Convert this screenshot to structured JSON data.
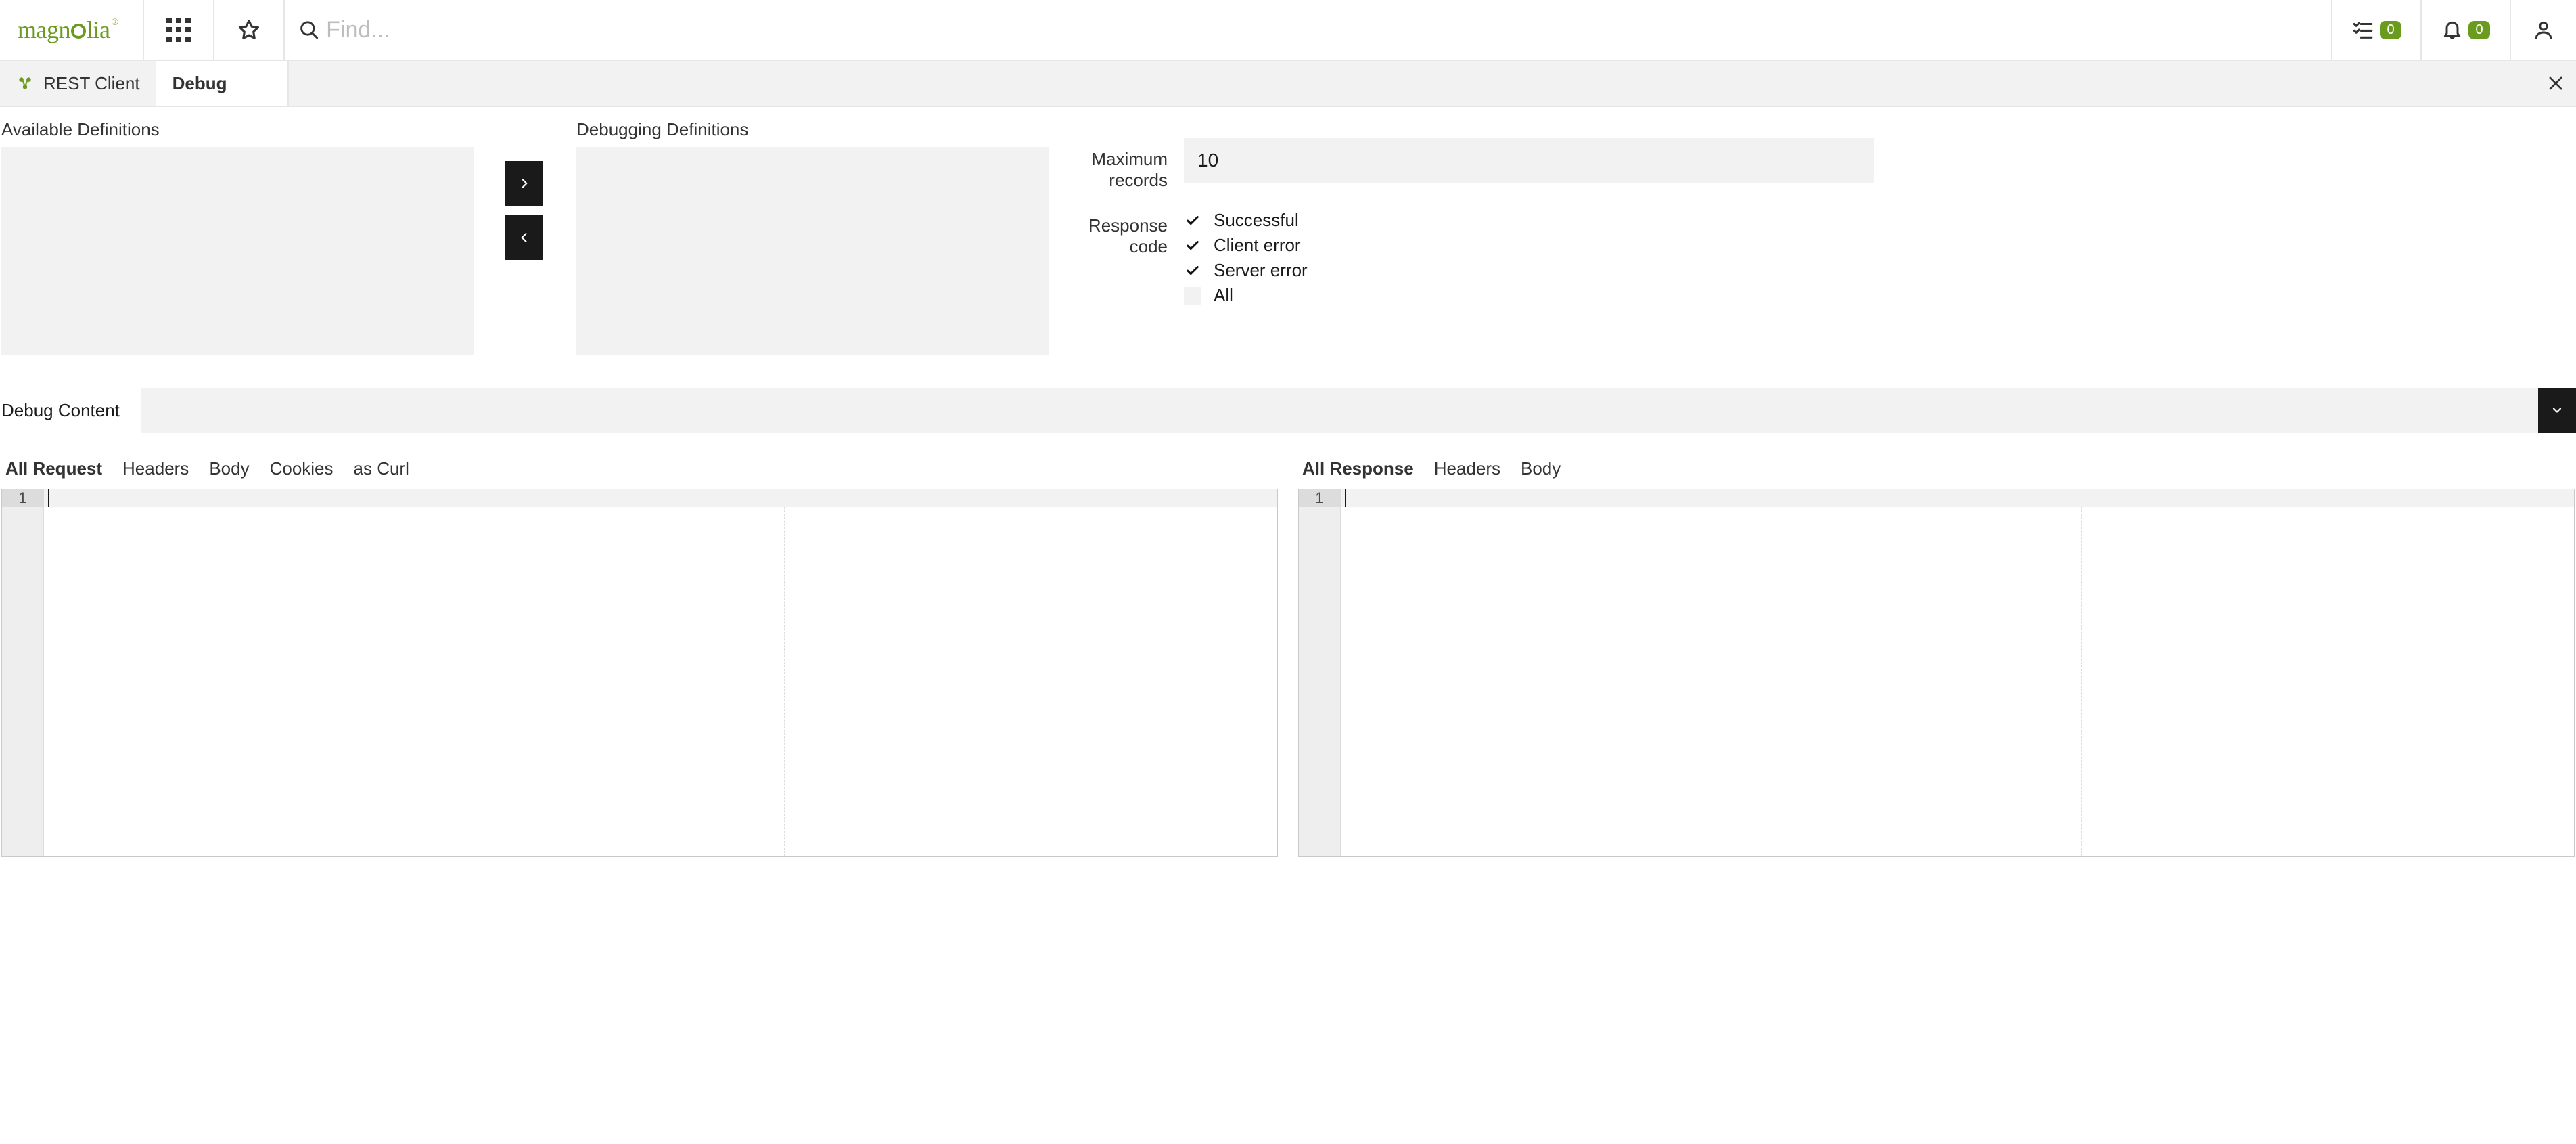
{
  "header": {
    "brand": "magnolia",
    "search_placeholder": "Find...",
    "tasks_badge": "0",
    "notifications_badge": "0"
  },
  "breadcrumb": {
    "app_name": "REST Client",
    "subapp_name": "Debug"
  },
  "panels": {
    "available_label": "Available Definitions",
    "debugging_label": "Debugging Definitions"
  },
  "settings": {
    "max_records_label": "Maximum records",
    "max_records_value": "10",
    "response_code_label": "Response code",
    "options": {
      "successful": {
        "label": "Successful",
        "checked": true
      },
      "client_error": {
        "label": "Client error",
        "checked": true
      },
      "server_error": {
        "label": "Server error",
        "checked": true
      },
      "all": {
        "label": "All",
        "checked": false
      }
    }
  },
  "debug_content": {
    "label": "Debug Content"
  },
  "request_pane": {
    "tabs": {
      "all": "All Request",
      "headers": "Headers",
      "body": "Body",
      "cookies": "Cookies",
      "as_curl": "as Curl"
    },
    "gutter_first_line": "1"
  },
  "response_pane": {
    "tabs": {
      "all": "All Response",
      "headers": "Headers",
      "body": "Body"
    },
    "gutter_first_line": "1"
  }
}
